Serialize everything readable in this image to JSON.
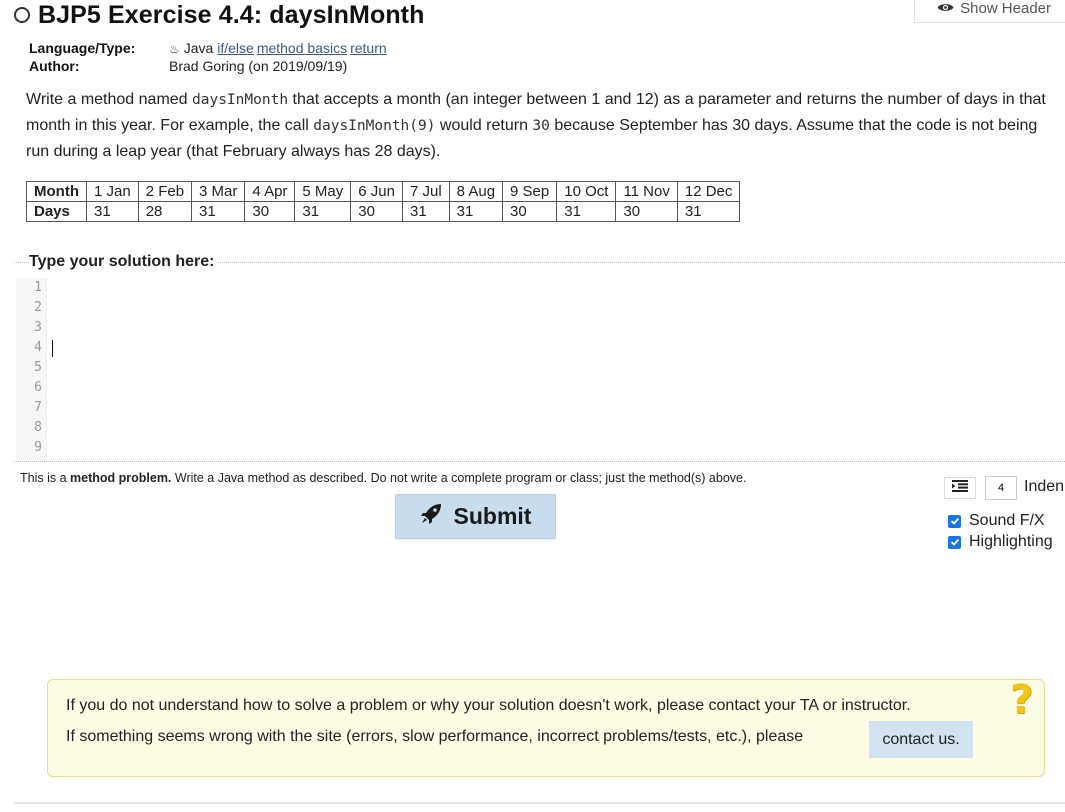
{
  "header": {
    "show_header_label": "Show Header",
    "title": "BJP5 Exercise 4.4: daysInMonth"
  },
  "meta": {
    "language_type_label": "Language/Type:",
    "language": "Java",
    "tags": [
      "if/else",
      "method basics",
      "return"
    ],
    "author_label": "Author:",
    "author": "Brad Goring (on 2019/09/19)"
  },
  "description": {
    "p1": "Write a method named ",
    "code1": "daysInMonth",
    "p2": " that accepts a month (an integer between 1 and 12) as a parameter and returns the number of days in that month in this year. For example, the call ",
    "code2": "daysInMonth(9)",
    "p3": " would return ",
    "code3": "30",
    "p4": " because September has 30 days. Assume that the code is not being run during a leap year (that February always has 28 days)."
  },
  "table": {
    "month_header": "Month",
    "days_header": "Days",
    "months": [
      "1 Jan",
      "2 Feb",
      "3 Mar",
      "4 Apr",
      "5 May",
      "6 Jun",
      "7 Jul",
      "8 Aug",
      "9 Sep",
      "10 Oct",
      "11 Nov",
      "12 Dec"
    ],
    "days": [
      "31",
      "28",
      "31",
      "30",
      "31",
      "30",
      "31",
      "31",
      "30",
      "31",
      "30",
      "31"
    ]
  },
  "editor": {
    "legend": "Type your solution here:",
    "line_numbers": [
      "1",
      "2",
      "3",
      "4",
      "5",
      "6",
      "7",
      "8",
      "9"
    ],
    "content": ""
  },
  "note": {
    "prefix": "This is a ",
    "bold": "method problem.",
    "suffix": " Write a Java method as described. Do not write a complete program or class; just the method(s) above."
  },
  "submit": {
    "label": "Submit"
  },
  "controls": {
    "indent_value": "4",
    "indent_label": "Inden",
    "sound_label": "Sound F/X",
    "sound_checked": true,
    "highlight_label": "Highlighting",
    "highlight_checked": true
  },
  "help": {
    "line1": "If you do not understand how to solve a problem or why your solution doesn't work, please contact your TA or instructor.",
    "line2": "If something seems wrong with the site (errors, slow performance, incorrect problems/tests, etc.), please",
    "contact_label": "contact us.",
    "icon": "question-mark-icon"
  },
  "colors": {
    "link": "#3a5a8c",
    "submit_bg": "#c9dceb",
    "help_bg": "#fdfde6",
    "help_border": "#e0e08a",
    "help_icon": "#f0c419",
    "checkbox": "#1a73e8"
  }
}
